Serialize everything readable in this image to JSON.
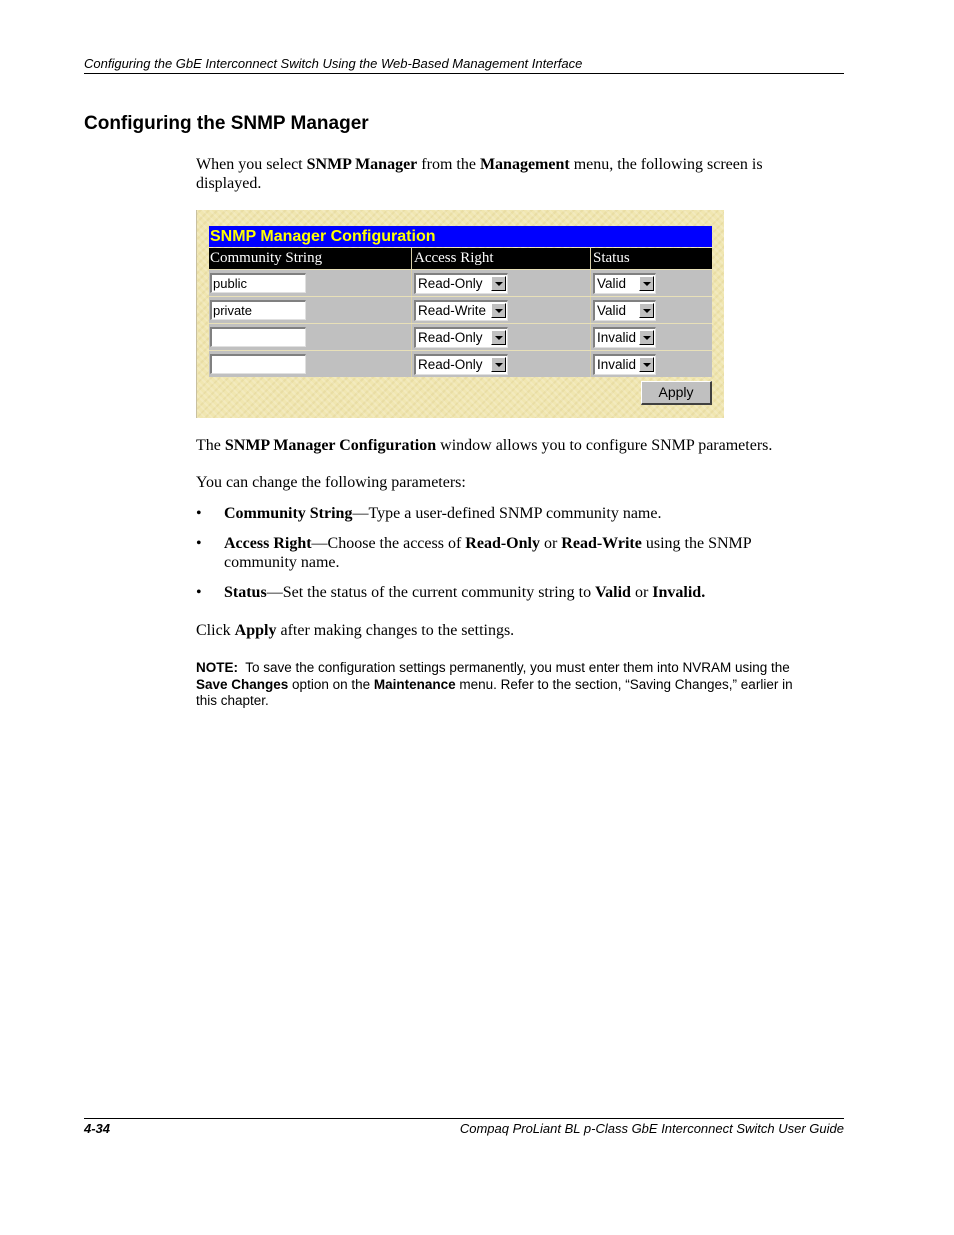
{
  "header": {
    "running_title": "Configuring the GbE Interconnect Switch Using the Web-Based Management Interface"
  },
  "section": {
    "title": "Configuring the SNMP Manager"
  },
  "intro": {
    "p1": "When you select ",
    "b1": "SNMP Manager",
    "p2": " from the ",
    "b2": "Management",
    "p3": " menu, the following screen is displayed."
  },
  "config_window": {
    "title": "SNMP Manager Configuration",
    "columns": [
      "Community String",
      "Access Right",
      "Status"
    ],
    "rows": [
      {
        "community": "public",
        "access": "Read-Only",
        "status": "Valid"
      },
      {
        "community": "private",
        "access": "Read-Write",
        "status": "Valid"
      },
      {
        "community": "",
        "access": "Read-Only",
        "status": "Invalid"
      },
      {
        "community": "",
        "access": "Read-Only",
        "status": "Invalid"
      }
    ],
    "apply_label": "Apply",
    "colors": {
      "title_bg": "#0000ff",
      "title_text": "#ffff00",
      "header_bg": "#000000",
      "row_bg": "#c0c0c0"
    }
  },
  "window_desc": {
    "p1": "The ",
    "b1": "SNMP Manager Configuration",
    "p2": " window allows you to configure SNMP parameters."
  },
  "change_intro": "You can change the following parameters:",
  "bullets": [
    {
      "term": "Community String",
      "text": "—Type a user-defined SNMP community name."
    },
    {
      "term": "Access Right",
      "text1": "—Choose the access of ",
      "b1": "Read-Only",
      "text2": " or ",
      "b2": "Read-Write",
      "text3": " using the SNMP community name."
    },
    {
      "term": "Status",
      "text1": "—Set the status of the current community string to ",
      "b1": "Valid",
      "text2": " or ",
      "b2": "Invalid."
    }
  ],
  "click_apply": {
    "p1": "Click ",
    "b1": "Apply",
    "p2": " after making changes to the settings."
  },
  "note": {
    "label": "NOTE:",
    "p1": "  To save the configuration settings permanently, you must enter them into NVRAM using the ",
    "b1": "Save Changes",
    "p2": " option on the ",
    "b2": "Maintenance",
    "p3": " menu. Refer to the section, “Saving Changes,” earlier in this chapter."
  },
  "footer": {
    "page_number": "4-34",
    "guide_title": "Compaq ProLiant BL p-Class GbE Interconnect Switch User Guide"
  }
}
